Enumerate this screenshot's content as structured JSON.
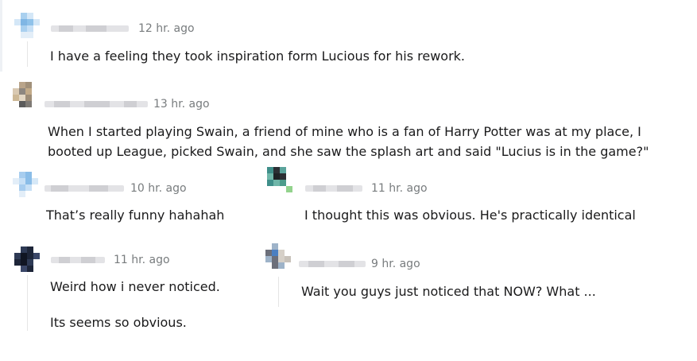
{
  "comments": [
    {
      "timestamp": "12 hr. ago",
      "body": "I have a feeling they took inspiration form Lucious for his rework.",
      "avatar_colors": [
        "#a9d0ef",
        "#8fc2ea",
        "#d4e7f7",
        "#7fb6e4"
      ]
    },
    {
      "timestamp": "13 hr. ago",
      "body_lines": [
        "When I started playing Swain, a friend of mine who is a fan of Harry Potter was at my place, I",
        "booted up League, picked Swain, and she saw the splash art and said \"Lucius is in the game?\""
      ],
      "avatar_colors": [
        "#b9a48a",
        "#8d8780",
        "#d9c9b2",
        "#5b5b5b"
      ]
    },
    {
      "timestamp": "10 hr. ago",
      "body": "That’s really funny hahahah",
      "avatar_colors": [
        "#a7cdef",
        "#c7e0f6",
        "#8abde8",
        "#e3eef8"
      ]
    },
    {
      "timestamp": "11 hr. ago",
      "body": "I thought this was obvious. He's practically identical",
      "avatar_colors": [
        "#3f8f8a",
        "#2c2f34",
        "#6fb6a9",
        "#93d38d"
      ]
    },
    {
      "timestamp": "11 hr. ago",
      "body_lines": [
        "Weird how i never noticed.",
        "Its seems so obvious."
      ],
      "avatar_colors": [
        "#1d2538",
        "#2e3a55",
        "#101522",
        "#3b4768"
      ]
    },
    {
      "timestamp": "9 hr. ago",
      "body": "Wait you guys just noticed that NOW? What ...",
      "avatar_colors": [
        "#4b7fc1",
        "#9eb3c9",
        "#d6d0c8",
        "#6c6f7a"
      ]
    }
  ]
}
